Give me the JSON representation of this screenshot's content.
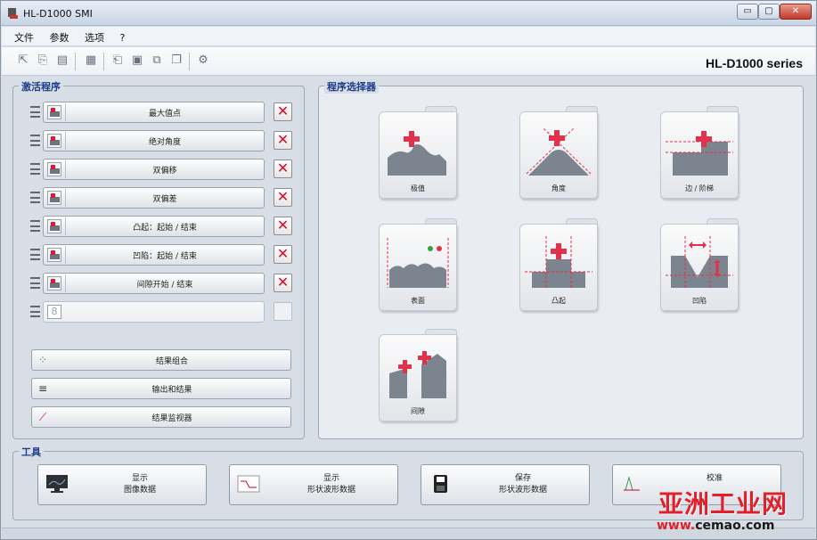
{
  "window": {
    "title": "HL-D1000 SMI",
    "brand": "HL-D1000 series"
  },
  "menu": [
    "文件",
    "参数",
    "选项",
    "?"
  ],
  "toolbar_icons": [
    "program-icon",
    "open-icon",
    "save-icon",
    "table-icon",
    "import-icon",
    "export-icon",
    "copy-icon",
    "paste-icon",
    "settings-icon"
  ],
  "active_programs": {
    "legend": "激活程序",
    "items": [
      {
        "label": "最大值点",
        "icon": "peak-icon",
        "removable": true
      },
      {
        "label": "绝对角度",
        "icon": "angle-icon",
        "removable": true
      },
      {
        "label": "双偏移",
        "icon": "dual-offset-icon",
        "removable": true
      },
      {
        "label": "双偏差",
        "icon": "dual-deviation-icon",
        "removable": true
      },
      {
        "label": "凸起：起始 / 结束",
        "icon": "bump-icon",
        "removable": true
      },
      {
        "label": "凹陷：起始 / 结束",
        "icon": "dent-icon",
        "removable": true
      },
      {
        "label": "间隙开始 / 结束",
        "icon": "gap-icon",
        "removable": true
      },
      {
        "label": "",
        "icon": "slot-8-icon",
        "removable": false,
        "slot_number": "8"
      }
    ],
    "extra_buttons": [
      {
        "label": "结果组合",
        "icon": "combine-icon"
      },
      {
        "label": "输出和结果",
        "icon": "output-icon"
      },
      {
        "label": "结果监视器",
        "icon": "monitor-icon"
      }
    ]
  },
  "program_selector": {
    "legend": "程序选择器",
    "folders": [
      {
        "label": "极值",
        "icon": "extremum-icon"
      },
      {
        "label": "角度",
        "icon": "angle-folder-icon"
      },
      {
        "label": "边 / 阶梯",
        "icon": "edge-step-icon"
      },
      {
        "label": "表面",
        "icon": "surface-icon"
      },
      {
        "label": "凸起",
        "icon": "bump-folder-icon"
      },
      {
        "label": "凹陷",
        "icon": "dent-folder-icon"
      },
      {
        "label": "间隙",
        "icon": "gap-folder-icon"
      }
    ]
  },
  "tools": {
    "legend": "工具",
    "buttons": [
      {
        "label": "显示\n图像数据",
        "icon": "monitor-display-icon"
      },
      {
        "label": "显示\n形状波形数据",
        "icon": "waveform-icon"
      },
      {
        "label": "保存\n形状波形数据",
        "icon": "floppy-icon"
      },
      {
        "label": "校准",
        "icon": "calibrate-icon"
      }
    ]
  },
  "watermark": {
    "text": "亚洲工业网",
    "url_prefix": "www.",
    "url_main": "cemao.com"
  },
  "colors": {
    "accent_red": "#d01020",
    "legend_blue": "#1d3d8a",
    "panel": "#d8dee6"
  }
}
